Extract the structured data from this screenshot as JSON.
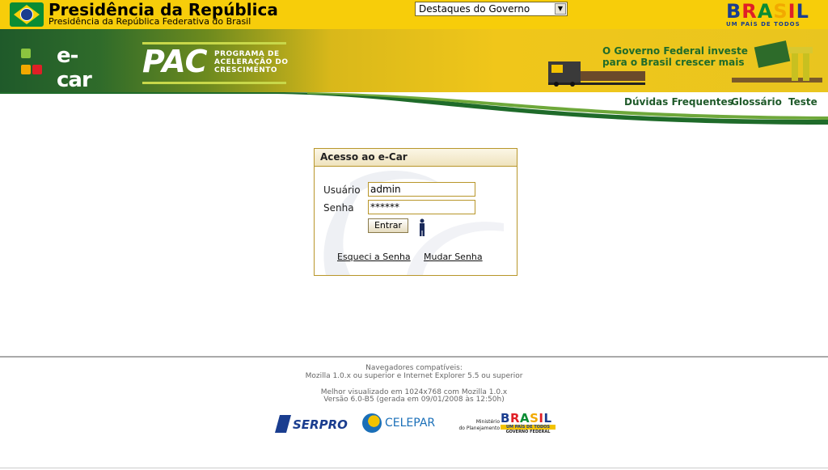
{
  "header": {
    "title": "Presidência da República",
    "subtitle": "Presidência da República Federativa do Brasil",
    "select_value": "Destaques do Governo",
    "brand_word": "BRASIL",
    "brand_slogan": "UM PAÍS DE TODOS"
  },
  "banner": {
    "ecar_logo": "e-car",
    "pac_logo": "PAC",
    "pac_subtitle_1": "PROGRAMA DE",
    "pac_subtitle_2": "ACELERAÇÃO DO",
    "pac_subtitle_3": "CRESCIMENTO",
    "tagline_1": "O Governo Federal investe",
    "tagline_2": "para o Brasil crescer mais"
  },
  "nav": {
    "items": [
      {
        "label": "Dúvidas Frequentes"
      },
      {
        "label": "Glossário"
      },
      {
        "label": "Teste"
      }
    ]
  },
  "login": {
    "title": "Acesso ao e-Car",
    "user_label": "Usuário",
    "user_value": "admin",
    "password_label": "Senha",
    "password_value": "******",
    "submit_label": "Entrar",
    "forgot_link": "Esqueci a Senha",
    "change_link": "Mudar Senha"
  },
  "footer": {
    "line1": "Navegadores compatíveis:",
    "line2": "Mozilla 1.0.x ou superior e Internet Explorer 5.5 ou superior",
    "line3": "Melhor visualizado em 1024x768 com Mozilla 1.0.x",
    "line4": "Versão 6.0-B5 (gerada em 09/01/2008 às 12:50h)",
    "logo_serpro": "SERPRO",
    "logo_celepar": "CELEPAR",
    "ministerio_1": "Ministério",
    "ministerio_2": "do Planejamento",
    "brasil_footer": "BRASIL",
    "brasil_footer_slogan": "UM PAÍS DE TODOS",
    "gov_federal": "GOVERNO FEDERAL"
  },
  "colors": {
    "gov_yellow": "#f7cd0a",
    "green": "#1f5a2a",
    "login_border": "#b8962a"
  }
}
